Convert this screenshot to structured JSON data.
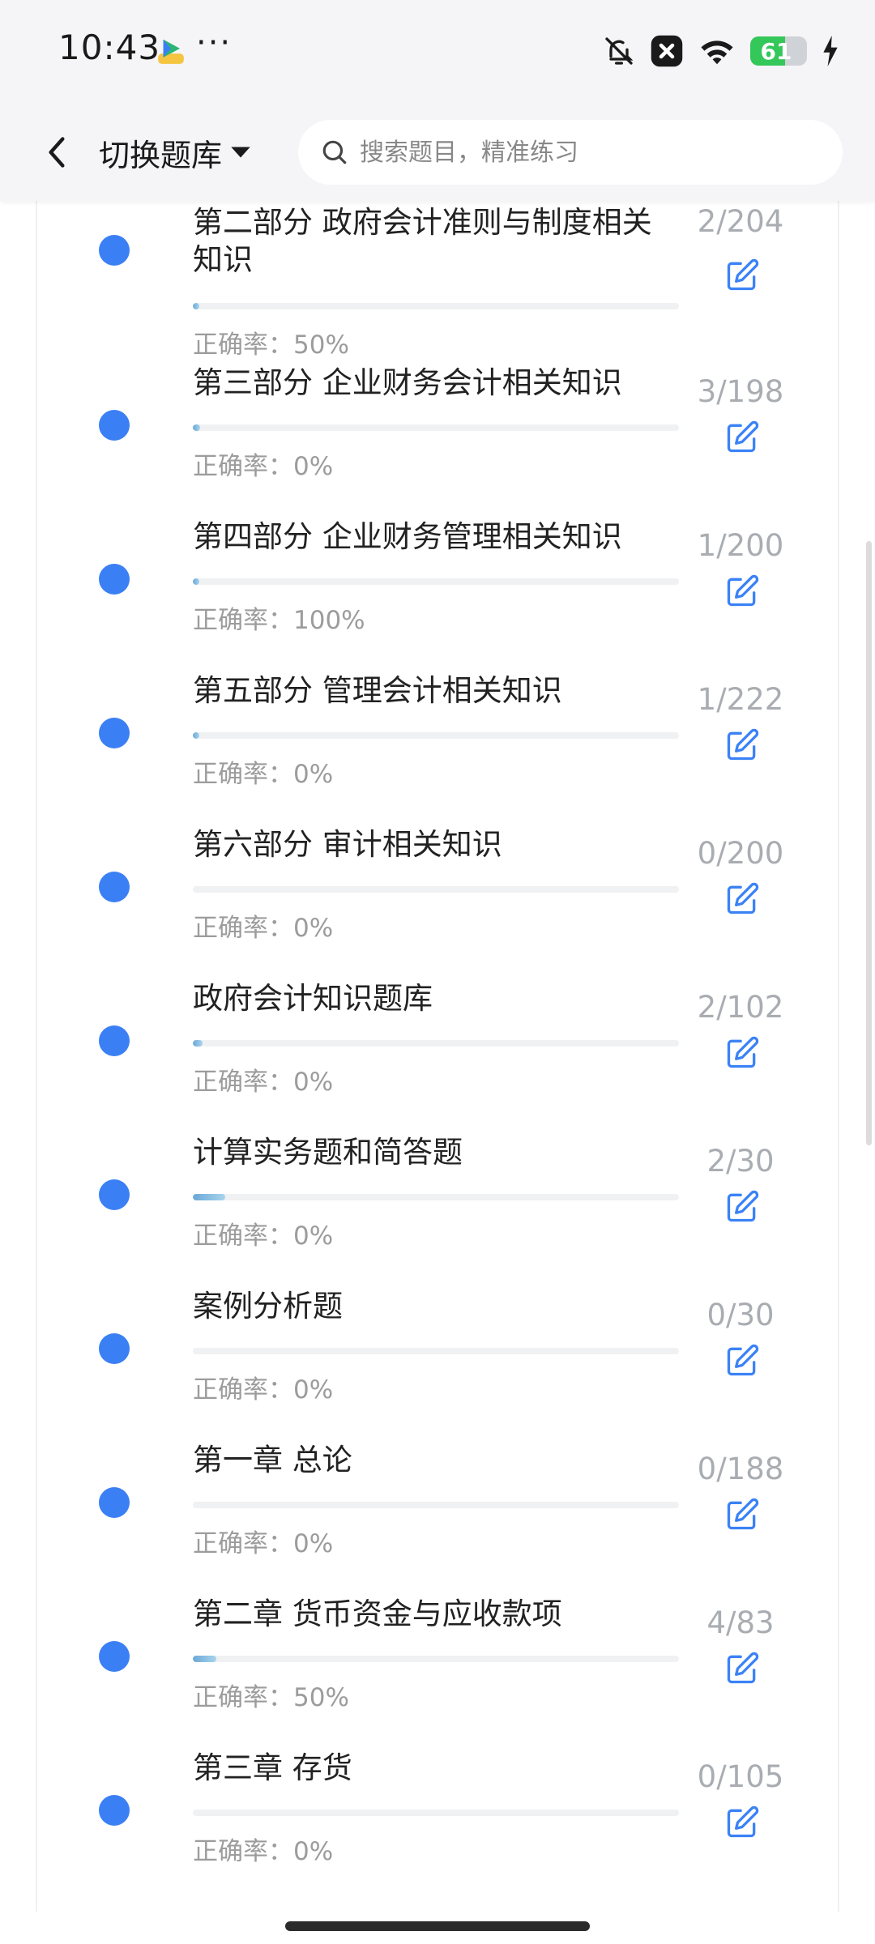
{
  "status_bar": {
    "time": "10:43",
    "more": "···",
    "battery_level": "61",
    "battery_fraction": 0.61,
    "icons": [
      "app-icon",
      "bell-off-icon",
      "close-box-icon",
      "wifi-icon",
      "battery-icon",
      "charging-bolt-icon"
    ]
  },
  "nav": {
    "title": "切换题库",
    "search_placeholder": "搜索题目，精准练习",
    "icons": [
      "back-arrow-icon",
      "caret-down-icon",
      "search-icon"
    ]
  },
  "items": [
    {
      "title": "第二部分 政府会计准则与制度相关知识",
      "accuracy": "正确率：50%",
      "count": "2/204",
      "done": 2,
      "total": 204
    },
    {
      "title": "第三部分 企业财务会计相关知识",
      "accuracy": "正确率：0%",
      "count": "3/198",
      "done": 3,
      "total": 198
    },
    {
      "title": "第四部分 企业财务管理相关知识",
      "accuracy": "正确率：100%",
      "count": "1/200",
      "done": 1,
      "total": 200
    },
    {
      "title": "第五部分 管理会计相关知识",
      "accuracy": "正确率：0%",
      "count": "1/222",
      "done": 1,
      "total": 222
    },
    {
      "title": "第六部分 审计相关知识",
      "accuracy": "正确率：0%",
      "count": "0/200",
      "done": 0,
      "total": 200
    },
    {
      "title": "政府会计知识题库",
      "accuracy": "正确率：0%",
      "count": "2/102",
      "done": 2,
      "total": 102
    },
    {
      "title": "计算实务题和简答题",
      "accuracy": "正确率：0%",
      "count": "2/30",
      "done": 2,
      "total": 30
    },
    {
      "title": "案例分析题",
      "accuracy": "正确率：0%",
      "count": "0/30",
      "done": 0,
      "total": 30
    },
    {
      "title": "第一章 总论",
      "accuracy": "正确率：0%",
      "count": "0/188",
      "done": 0,
      "total": 188
    },
    {
      "title": "第二章 货币资金与应收款项",
      "accuracy": "正确率：50%",
      "count": "4/83",
      "done": 4,
      "total": 83
    },
    {
      "title": "第三章 存货",
      "accuracy": "正确率：0%",
      "count": "0/105",
      "done": 0,
      "total": 105
    }
  ],
  "colors": {
    "dot": "#3b7ff5",
    "edit_icon": "#3b82f6",
    "count_text": "#a9adb2",
    "accuracy_text": "#9c9c9c"
  }
}
